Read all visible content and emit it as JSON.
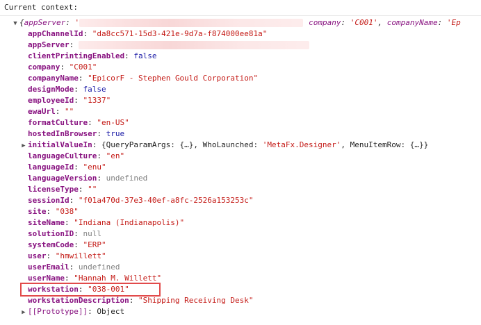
{
  "header": {
    "label": "Current context:"
  },
  "summary": {
    "open": "{",
    "key_app_server": "appServer",
    "app_server_prefix": "'",
    "tail_company_key": "company",
    "tail_company_value": "'C001'",
    "tail_company_name_key": "companyName",
    "tail_company_name_value": "'Ep"
  },
  "properties": [
    {
      "key": "appChannelId",
      "value": "\"da8cc571-15d3-421e-9d7a-f874000ee81a\"",
      "type": "string"
    },
    {
      "key": "appServer",
      "value": "",
      "type": "redacted"
    },
    {
      "key": "clientPrintingEnabled",
      "value": "false",
      "type": "keyword"
    },
    {
      "key": "company",
      "value": "\"C001\"",
      "type": "string"
    },
    {
      "key": "companyName",
      "value": "\"EpicorF - Stephen Gould Corporation\"",
      "type": "string"
    },
    {
      "key": "designMode",
      "value": "false",
      "type": "keyword"
    },
    {
      "key": "employeeId",
      "value": "\"1337\"",
      "type": "string"
    },
    {
      "key": "ewaUrl",
      "value": "\"\"",
      "type": "string"
    },
    {
      "key": "formatCulture",
      "value": "\"en-US\"",
      "type": "string"
    },
    {
      "key": "hostedInBrowser",
      "value": "true",
      "type": "keyword"
    },
    {
      "key": "initialValueIn",
      "value": "{QueryParamArgs: {…}, WhoLaunched: 'MetaFx.Designer', MenuItemRow: {…}}",
      "type": "object"
    },
    {
      "key": "languageCulture",
      "value": "\"en\"",
      "type": "string"
    },
    {
      "key": "languageId",
      "value": "\"enu\"",
      "type": "string"
    },
    {
      "key": "languageVersion",
      "value": "undefined",
      "type": "muted"
    },
    {
      "key": "licenseType",
      "value": "\"\"",
      "type": "string"
    },
    {
      "key": "sessionId",
      "value": "\"f01a470d-37e3-40ef-a8fc-2526a153253c\"",
      "type": "string"
    },
    {
      "key": "site",
      "value": "\"038\"",
      "type": "string"
    },
    {
      "key": "siteName",
      "value": "\"Indiana (Indianapolis)\"",
      "type": "string"
    },
    {
      "key": "solutionID",
      "value": "null",
      "type": "muted"
    },
    {
      "key": "systemCode",
      "value": "\"ERP\"",
      "type": "string"
    },
    {
      "key": "user",
      "value": "\"hmwillett\"",
      "type": "string"
    },
    {
      "key": "userEmail",
      "value": "undefined",
      "type": "muted"
    },
    {
      "key": "userName",
      "value": "\"Hannah M. Willett\"",
      "type": "string"
    },
    {
      "key": "workstation",
      "value": "\"038-001\"",
      "type": "string"
    },
    {
      "key": "workstationDescription",
      "value": "\"Shipping Receiving Desk\"",
      "type": "string"
    }
  ],
  "initial_value_parts": {
    "open": "{QueryParamArgs: {…}, WhoLaunched: ",
    "who": "'MetaFx.Designer'",
    "close": ", MenuItemRow: {…}}"
  },
  "prototype": {
    "key": "[[Prototype]]",
    "value": "Object"
  },
  "colors": {
    "key": "#881280",
    "string": "#c41a16",
    "keyword": "#1a1aa6",
    "muted": "#808080",
    "highlight": "#e24a4a"
  }
}
